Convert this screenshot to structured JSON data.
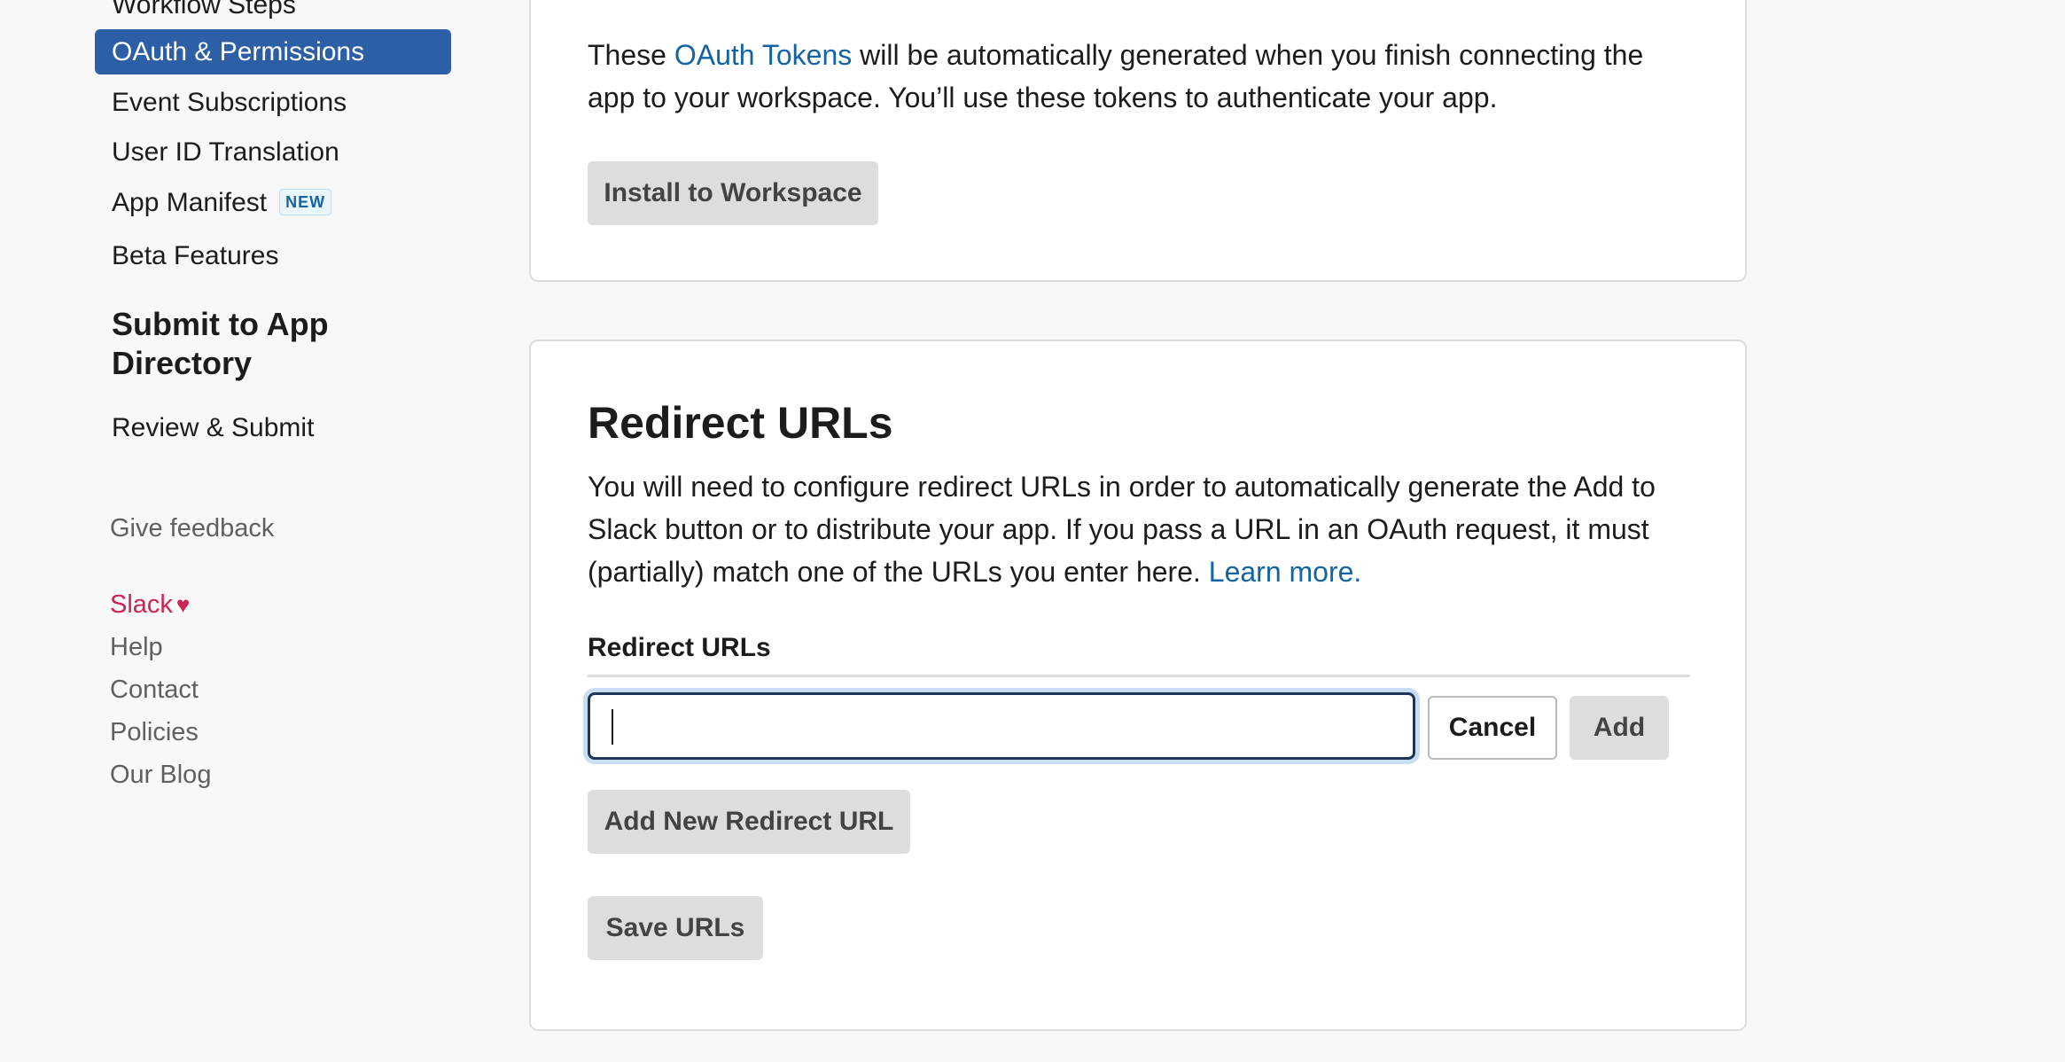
{
  "sidebar": {
    "items": [
      {
        "label": "Workflow Steps"
      },
      {
        "label": "OAuth & Permissions"
      },
      {
        "label": "Event Subscriptions"
      },
      {
        "label": "User ID Translation"
      },
      {
        "label": "App Manifest",
        "badge": "NEW"
      },
      {
        "label": "Beta Features"
      }
    ],
    "submit_heading": "Submit to App Directory",
    "review_label": "Review & Submit",
    "feedback_label": "Give feedback",
    "footer": {
      "slack": "Slack",
      "heart_icon": "heart-icon",
      "help": "Help",
      "contact": "Contact",
      "policies": "Policies",
      "blog": "Our Blog"
    }
  },
  "tokens_card": {
    "text_before": "These ",
    "link": "OAuth Tokens",
    "text_after": " will be automatically generated when you finish connecting the app to your workspace. You’ll use these tokens to authenticate your app.",
    "install_button": "Install to Workspace"
  },
  "redirect_card": {
    "title": "Redirect URLs",
    "description": "You will need to configure redirect URLs in order to automatically generate the Add to Slack button or to distribute your app. If you pass a URL in an OAuth request, it must (partially) match one of the URLs you enter here. ",
    "learn_more": "Learn more.",
    "field_label": "Redirect URLs",
    "input_value": "",
    "input_placeholder": "",
    "cancel_button": "Cancel",
    "add_button": "Add",
    "add_new_button": "Add New Redirect URL",
    "save_button": "Save URLs"
  },
  "colors": {
    "accent": "#2c5fa5",
    "link": "#1264a3",
    "slack_red": "#cd2553"
  }
}
